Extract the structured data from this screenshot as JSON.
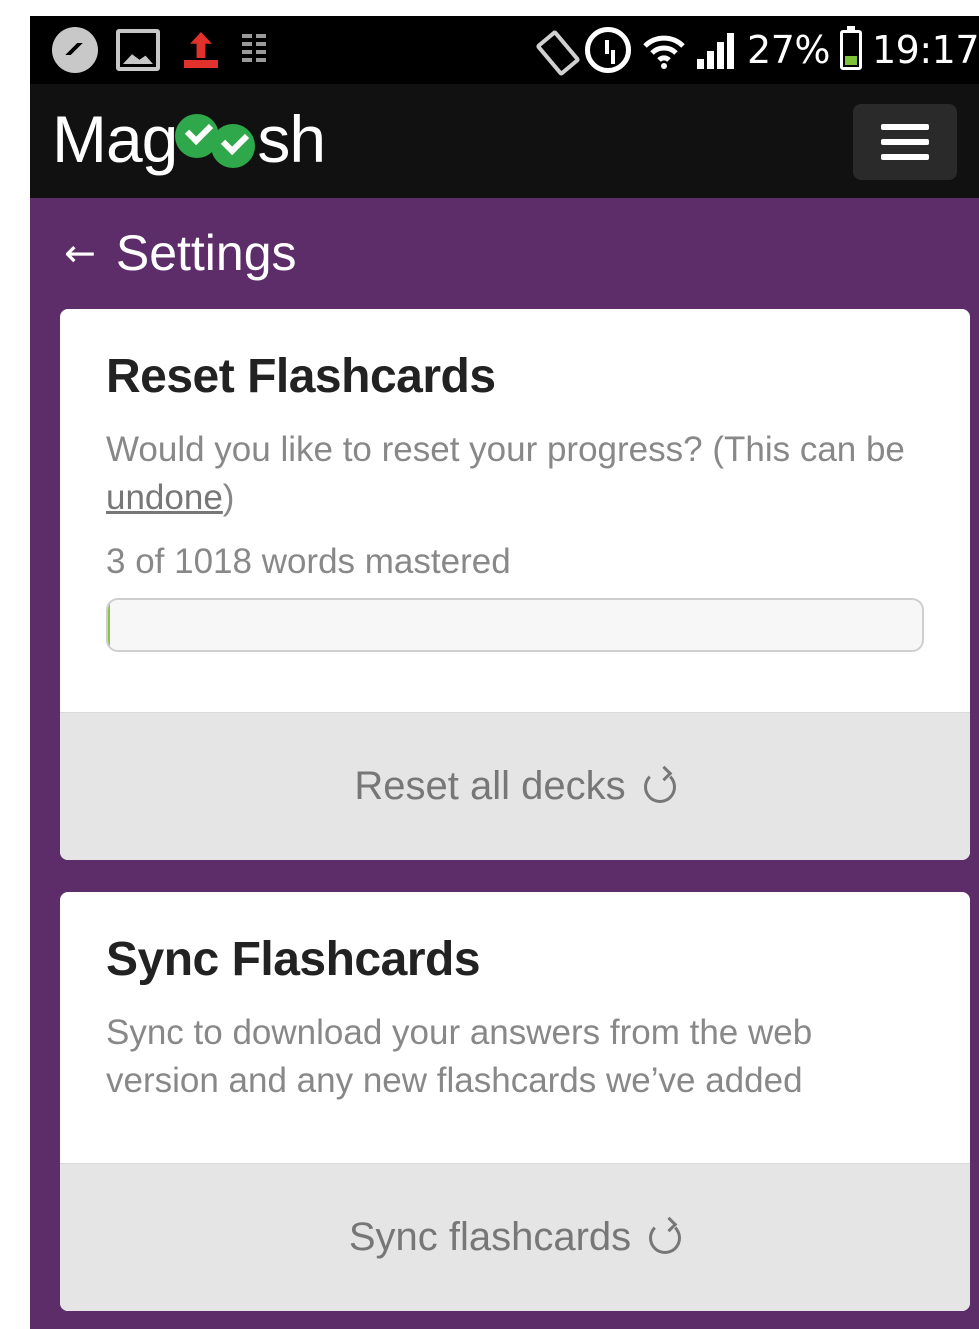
{
  "status_bar": {
    "battery_percent_label": "27%",
    "time": "19:17",
    "icons_left": [
      "messenger-icon",
      "gallery-icon",
      "upload-icon",
      "download-icon"
    ],
    "icons_right": [
      "vibrate-icon",
      "alarm-icon",
      "wifi-icon",
      "signal-icon",
      "battery-icon"
    ]
  },
  "app_bar": {
    "logo_prefix": "Mag",
    "logo_suffix": "sh",
    "logo_accent_color": "#2ea84a"
  },
  "header": {
    "back_arrow": "←",
    "title": "Settings"
  },
  "reset_card": {
    "title": "Reset Flashcards",
    "description_start": "Would you like to reset your progress? (This can be ",
    "description_link": "undone",
    "description_end": ")",
    "mastered_text": "3 of 1018 words mastered",
    "progress_fraction": 0.0029,
    "action_label": "Reset all decks"
  },
  "sync_card": {
    "title": "Sync Flashcards",
    "description": "Sync to download your answers from the web version and any new flashcards we’ve added",
    "action_label": "Sync flashcards"
  },
  "colors": {
    "background_purple": "#5d2d6a",
    "status_bar": "#000000",
    "app_bar": "#111111",
    "card": "#ffffff",
    "action_bar": "#e5e5e5"
  }
}
